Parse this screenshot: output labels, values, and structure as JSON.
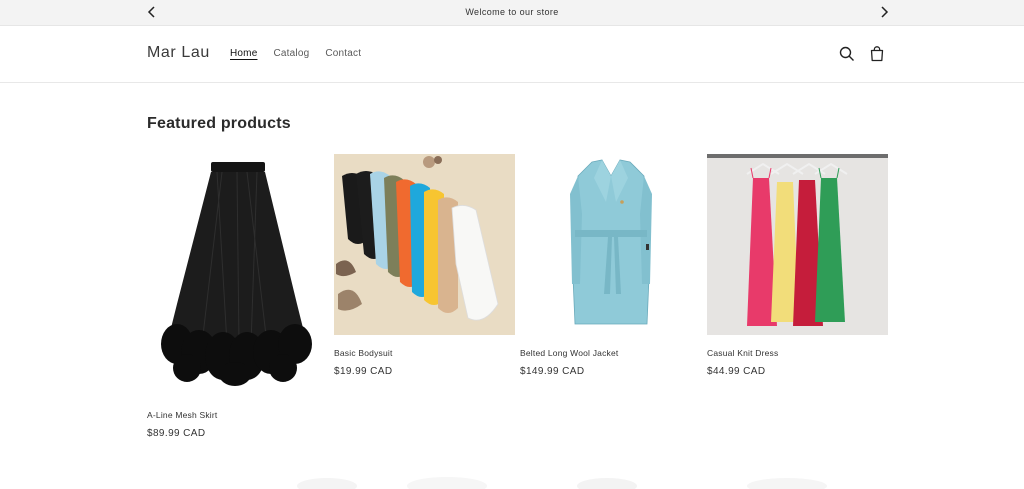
{
  "announcement": {
    "message": "Welcome to our store",
    "prev_icon": "chevron-left-icon",
    "next_icon": "chevron-right-icon"
  },
  "header": {
    "logo": "Mar Lau",
    "nav": [
      {
        "label": "Home",
        "active": true
      },
      {
        "label": "Catalog",
        "active": false
      },
      {
        "label": "Contact",
        "active": false
      }
    ],
    "icons": [
      "search-icon",
      "cart-icon"
    ]
  },
  "section": {
    "title": "Featured products"
  },
  "products": [
    {
      "title": "A-Line Mesh Skirt",
      "price": "$89.99 CAD"
    },
    {
      "title": "Basic Bodysuit",
      "price": "$19.99 CAD"
    },
    {
      "title": "Belted Long Wool Jacket",
      "price": "$149.99 CAD"
    },
    {
      "title": "Casual Knit Dress",
      "price": "$44.99 CAD"
    }
  ],
  "colors": {
    "announcement_bg": "#f3f3f3",
    "text": "#121212",
    "border": "#e8e8e8"
  }
}
